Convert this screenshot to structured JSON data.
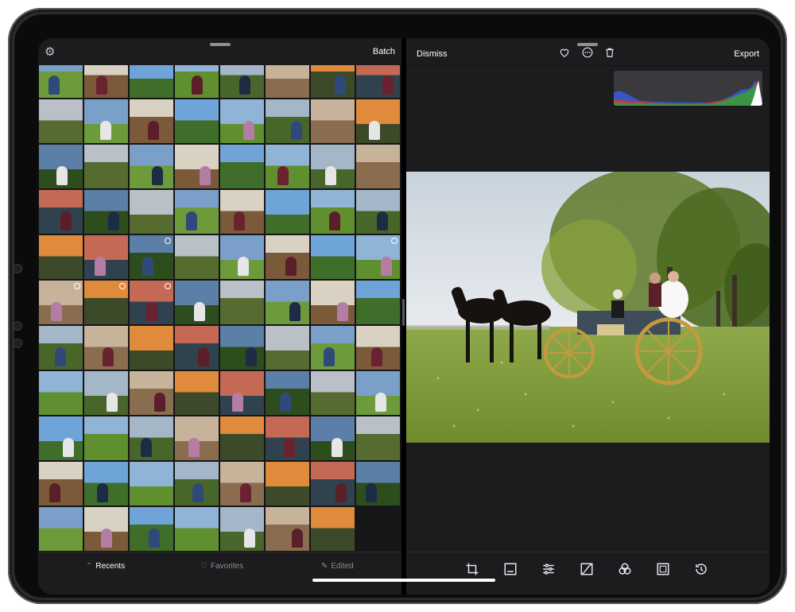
{
  "left_pane": {
    "gear_icon": "gear-icon",
    "batch_label": "Batch",
    "tabs": [
      {
        "label": "Recents",
        "icon": "chevron-up-icon",
        "active": true
      },
      {
        "label": "Favorites",
        "icon": "heart-icon",
        "active": false
      },
      {
        "label": "Edited",
        "icon": "pencil-icon",
        "active": false
      }
    ]
  },
  "right_pane": {
    "dismiss_label": "Dismiss",
    "export_label": "Export",
    "toolbar_icons": [
      "heart-icon",
      "more-icon",
      "trash-icon"
    ],
    "tools": [
      "crop-icon",
      "filters-icon",
      "adjust-icon",
      "curves-icon",
      "color-icon",
      "frame-icon",
      "history-icon"
    ]
  },
  "colors": {
    "accent_red": "#ff453a",
    "background": "#1c1c1e",
    "text": "#ffffff",
    "muted_text": "#8e8e93"
  }
}
